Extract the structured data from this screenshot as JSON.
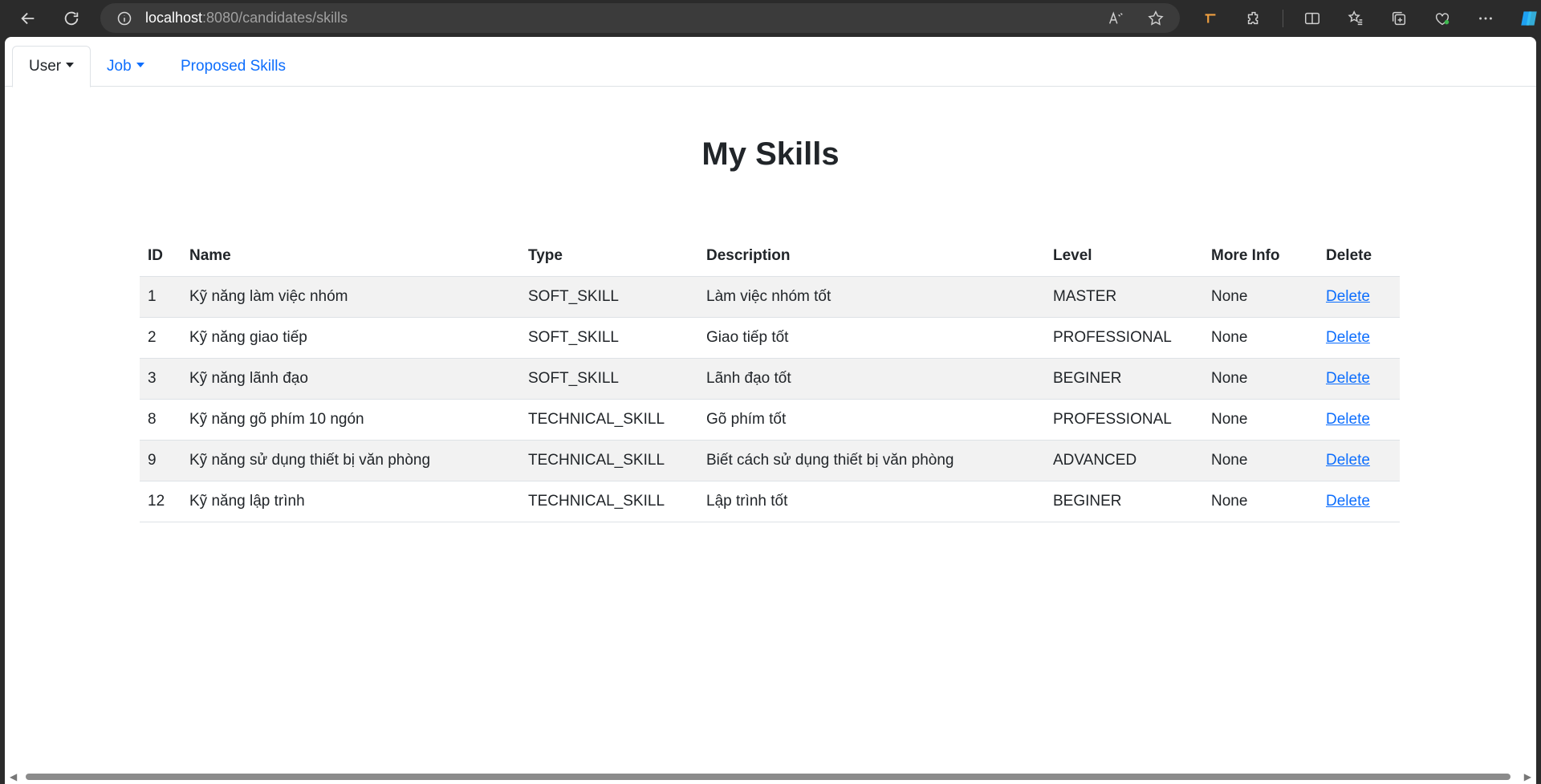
{
  "browser": {
    "url_host": "localhost",
    "url_path": ":8080/candidates/skills"
  },
  "tabs": [
    {
      "label": "User",
      "active": true,
      "dropdown": true
    },
    {
      "label": "Job",
      "active": false,
      "dropdown": true
    },
    {
      "label": "Proposed Skills",
      "active": false,
      "dropdown": false
    }
  ],
  "page": {
    "title": "My Skills"
  },
  "table": {
    "headers": [
      "ID",
      "Name",
      "Type",
      "Description",
      "Level",
      "More Info",
      "Delete"
    ],
    "rows": [
      {
        "id": "1",
        "name": "Kỹ năng làm việc nhóm",
        "type": "SOFT_SKILL",
        "description": "Làm việc nhóm tốt",
        "level": "MASTER",
        "more_info": "None",
        "delete": "Delete"
      },
      {
        "id": "2",
        "name": "Kỹ năng giao tiếp",
        "type": "SOFT_SKILL",
        "description": "Giao tiếp tốt",
        "level": "PROFESSIONAL",
        "more_info": "None",
        "delete": "Delete"
      },
      {
        "id": "3",
        "name": "Kỹ năng lãnh đạo",
        "type": "SOFT_SKILL",
        "description": "Lãnh đạo tốt",
        "level": "BEGINER",
        "more_info": "None",
        "delete": "Delete"
      },
      {
        "id": "8",
        "name": "Kỹ năng gõ phím 10 ngón",
        "type": "TECHNICAL_SKILL",
        "description": "Gõ phím tốt",
        "level": "PROFESSIONAL",
        "more_info": "None",
        "delete": "Delete"
      },
      {
        "id": "9",
        "name": "Kỹ năng sử dụng thiết bị văn phòng",
        "type": "TECHNICAL_SKILL",
        "description": "Biết cách sử dụng thiết bị văn phòng",
        "level": "ADVANCED",
        "more_info": "None",
        "delete": "Delete"
      },
      {
        "id": "12",
        "name": "Kỹ năng lập trình",
        "type": "TECHNICAL_SKILL",
        "description": "Lập trình tốt",
        "level": "BEGINER",
        "more_info": "None",
        "delete": "Delete"
      }
    ]
  },
  "colors": {
    "link": "#0d6efd",
    "striped_row": "#f2f2f2",
    "browser_chrome": "#2b2b2b"
  }
}
